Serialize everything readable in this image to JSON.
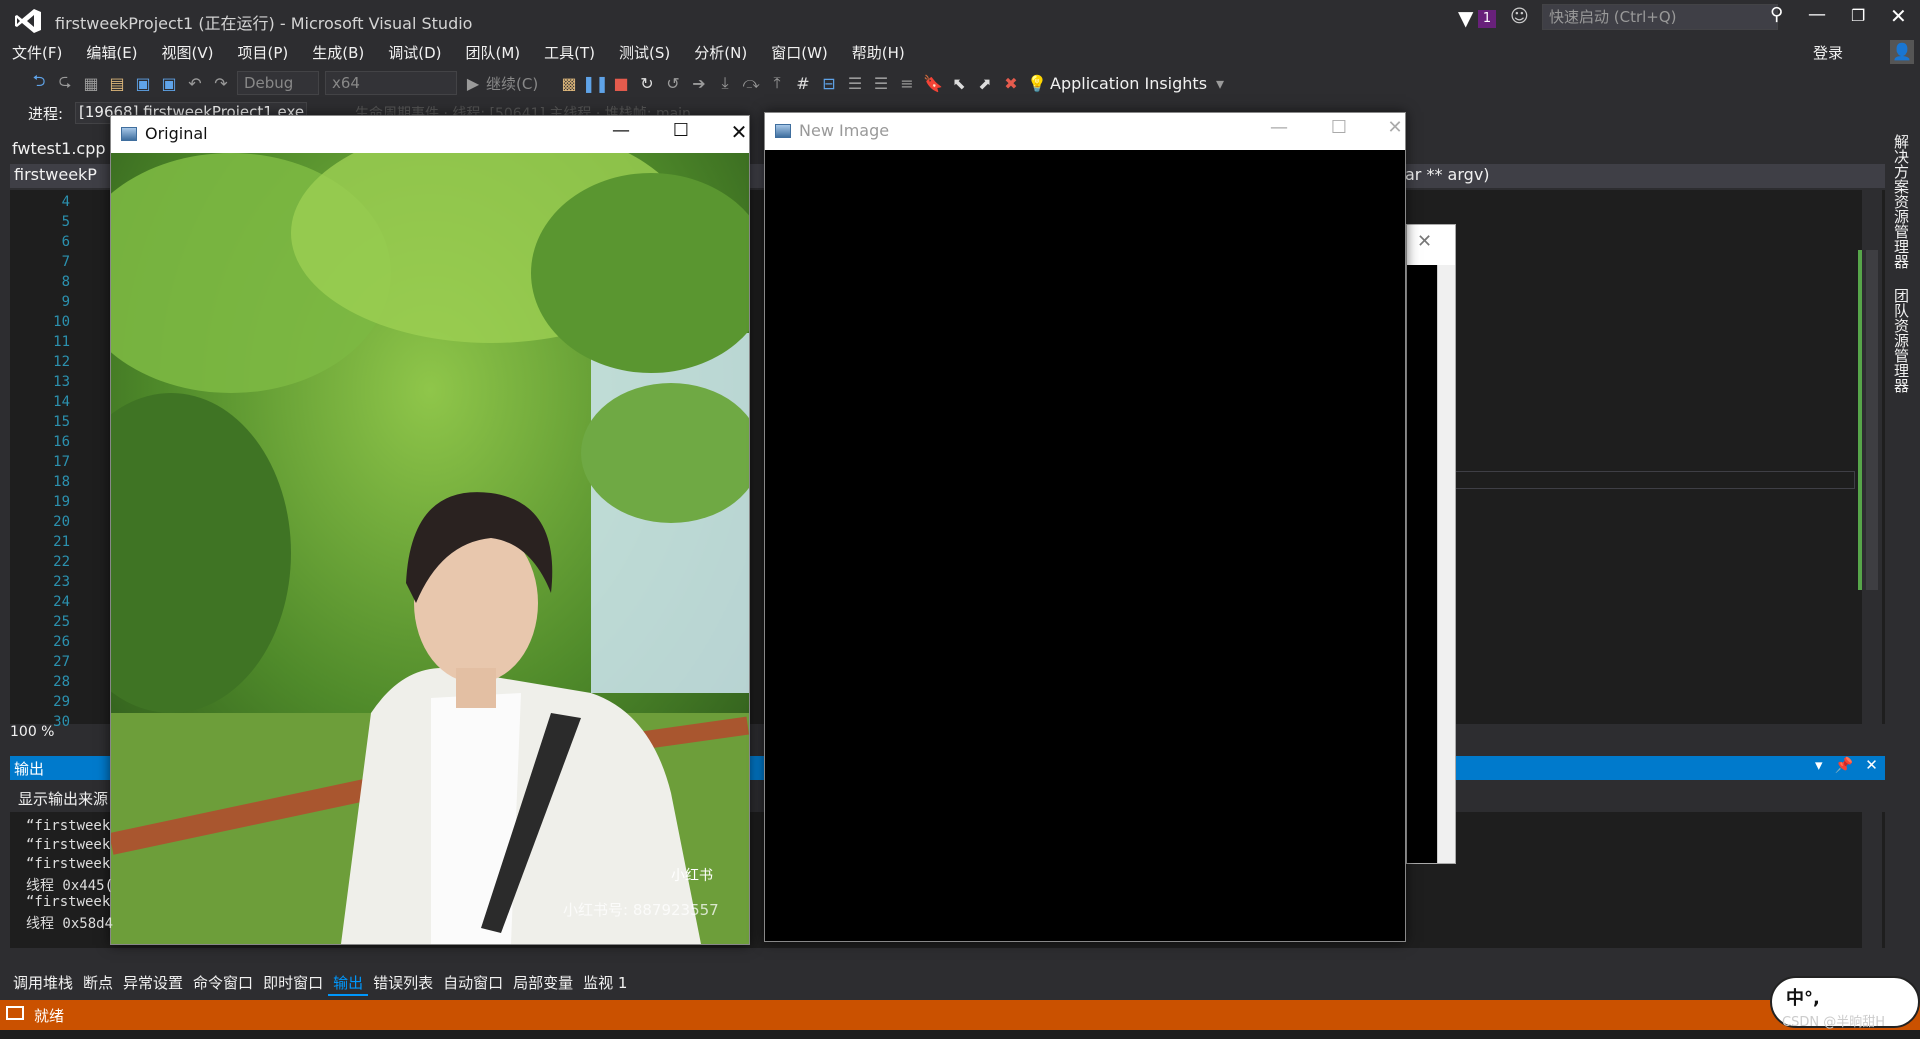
{
  "window": {
    "title": "firstweekProject1 (正在运行) - Microsoft Visual Studio",
    "notification_count": "1",
    "quick_launch_placeholder": "快速启动 (Ctrl+Q)",
    "login": "登录"
  },
  "menu": [
    "文件(F)",
    "编辑(E)",
    "视图(V)",
    "项目(P)",
    "生成(B)",
    "调试(D)",
    "团队(M)",
    "工具(T)",
    "测试(S)",
    "分析(N)",
    "窗口(W)",
    "帮助(H)"
  ],
  "toolbar": {
    "config": "Debug",
    "platform": "x64",
    "continue": "继续(C)",
    "app_insights": "Application Insights"
  },
  "process": {
    "label": "进程:",
    "value": "[19668] firstweekProject1.exe",
    "partial_text": "生命周期事件 · 线程: [50641] 主线程 · 堆栈帧: main"
  },
  "editor": {
    "file_tab": "fwtest1.cpp",
    "nav_left": "firstweekP",
    "nav_right": "ar ** argv)",
    "line_numbers": [
      "4",
      "5",
      "6",
      "7",
      "8",
      "9",
      "10",
      "11",
      "12",
      "13",
      "14",
      "15",
      "16",
      "17",
      "18",
      "19",
      "20",
      "21",
      "22",
      "23",
      "24",
      "25",
      "26",
      "27",
      "28",
      "29",
      "30"
    ],
    "zoom": "100 %"
  },
  "side_tabs": [
    "解决方案资源管理器",
    "团队资源管理器"
  ],
  "output": {
    "title": "输出",
    "source_label": "显示输出来源",
    "lines": [
      "“firstweek",
      "“firstweek",
      "“firstweek",
      "线程 0x445(",
      "“firstweek",
      "线程 0x58d4"
    ]
  },
  "bottom_tabs": [
    "调用堆栈",
    "断点",
    "异常设置",
    "命令窗口",
    "即时窗口",
    "输出",
    "错误列表",
    "自动窗口",
    "局部变量",
    "监视 1"
  ],
  "bottom_active_tab": "输出",
  "status": {
    "text": "就绪"
  },
  "cv_windows": {
    "original_title": "Original",
    "new_title": "New Image",
    "photo_watermark": "小红书号: 887923557",
    "photo_badge": "小红书"
  },
  "watermark": {
    "text": "CSDN @半晌甜H",
    "badge": "中°,"
  }
}
